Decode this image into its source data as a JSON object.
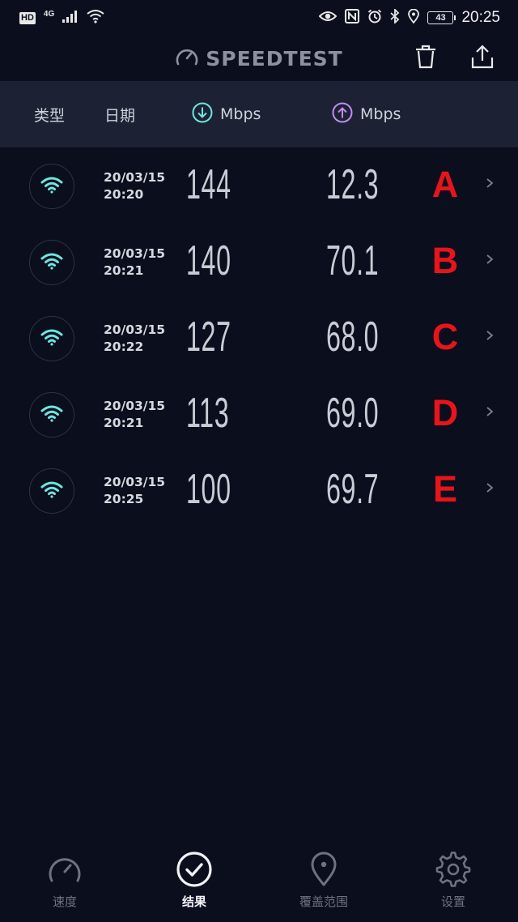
{
  "status_bar": {
    "hd": "HD",
    "network": "4G",
    "battery": "43",
    "time": "20:25"
  },
  "header": {
    "title": "SPEEDTEST",
    "trash_icon": "trash-icon",
    "share_icon": "share-icon"
  },
  "columns": {
    "type": "类型",
    "date": "日期",
    "download_unit": "Mbps",
    "upload_unit": "Mbps",
    "download_color": "#6ee6e0",
    "upload_color": "#c58bf0"
  },
  "results": [
    {
      "date": "20/03/15",
      "time": "20:20",
      "download": "144",
      "upload": "12.3",
      "tag": "A"
    },
    {
      "date": "20/03/15",
      "time": "20:21",
      "download": "140",
      "upload": "70.1",
      "tag": "B"
    },
    {
      "date": "20/03/15",
      "time": "20:22",
      "download": "127",
      "upload": "68.0",
      "tag": "C"
    },
    {
      "date": "20/03/15",
      "time": "20:21",
      "download": "113",
      "upload": "69.0",
      "tag": "D"
    },
    {
      "date": "20/03/15",
      "time": "20:25",
      "download": "100",
      "upload": "69.7",
      "tag": "E"
    }
  ],
  "nav": {
    "items": [
      {
        "label": "速度",
        "icon": "speedometer-icon"
      },
      {
        "label": "结果",
        "icon": "check-circle-icon",
        "active": true
      },
      {
        "label": "覆盖范围",
        "icon": "map-pin-icon"
      },
      {
        "label": "设置",
        "icon": "gear-icon"
      }
    ]
  },
  "colors": {
    "background": "#0b0e1d",
    "header_band": "#1c2233",
    "wifi": "#6ee6e0",
    "tag": "#e8141b"
  }
}
